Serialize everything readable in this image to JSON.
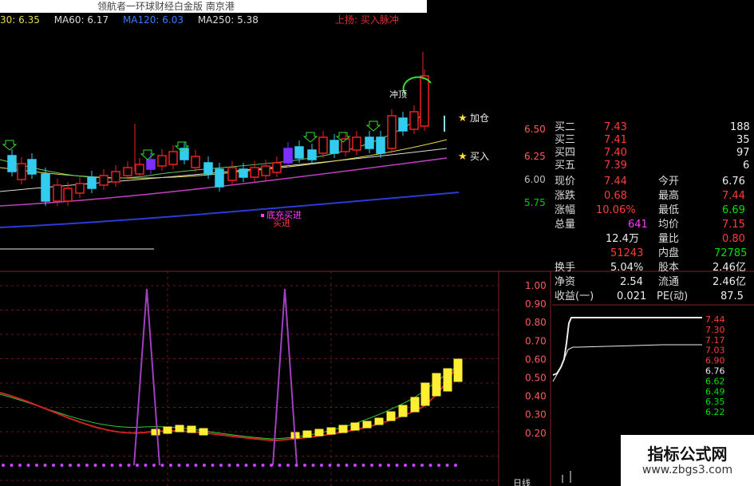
{
  "title": "领航者一环球财经白金版   南京港",
  "ma_bar": [
    {
      "text": "30: 6.35",
      "color": "#e8d84a"
    },
    {
      "text": "MA60: 6.17",
      "color": "#dcdcdc"
    },
    {
      "text": "MA120: 6.03",
      "color": "#3b7bff"
    },
    {
      "text": "MA250: 5.38",
      "color": "#dcdcdc"
    }
  ],
  "signal_text": "上扬: 买入脉冲",
  "price_axis": [
    "6.50",
    "6.25",
    "6.00",
    "5.75"
  ],
  "annotations": {
    "jia_cang": "加仓",
    "mai_ru": "买入",
    "chong": "冲顶",
    "bottom1": "底充买进",
    "bottom2": "买进"
  },
  "osc_axis": [
    "1.00",
    "0.90",
    "0.80",
    "0.70",
    "0.60",
    "0.50",
    "0.40",
    "0.30",
    "0.20"
  ],
  "mini_axis": [
    "7.44",
    "7.30",
    "7.17",
    "7.03",
    "6.90",
    "6.76",
    "6.62",
    "6.49",
    "6.35",
    "6.22"
  ],
  "mini_axis_colors": [
    "#ff3b3b",
    "#ff3b3b",
    "#ff3b3b",
    "#ff3b3b",
    "#ff3b3b",
    "#eeeeee",
    "#00e000",
    "#00e000",
    "#00e000",
    "#00e000"
  ],
  "order_book": [
    {
      "label": "买二",
      "price": "7.43",
      "vol": "188"
    },
    {
      "label": "买三",
      "price": "7.41",
      "vol": "35"
    },
    {
      "label": "买四",
      "price": "7.40",
      "vol": "97"
    },
    {
      "label": "买五",
      "price": "7.39",
      "vol": "6"
    }
  ],
  "quote": {
    "xianjia_lbl": "现价",
    "xianjia": "7.44",
    "jinkai_lbl": "今开",
    "jinkai": "6.76",
    "zhangdie_lbl": "涨跌",
    "zhangdie": "0.68",
    "zuigao_lbl": "最高",
    "zuigao": "7.44",
    "zhangfu_lbl": "涨幅",
    "zhangfu": "10.06%",
    "zuidi_lbl": "最低",
    "zuidi": "6.69",
    "zongliang_lbl": "总量",
    "zongliang": "641",
    "junjia_lbl": "均价",
    "junjia": "7.15",
    "liang": "12.4万",
    "liangbi_lbl": "量比",
    "liangbi": "0.80",
    "waipan": "51243",
    "neipan_lbl": "内盘",
    "neipan": "72785",
    "huanshou_lbl": "换手",
    "huanshou": "5.04%",
    "guben_lbl": "股本",
    "guben": "2.46亿",
    "jingzi_lbl": "净资",
    "jingzi": "2.54",
    "liutong_lbl": "流通",
    "liutong": "2.46亿",
    "shouyi_lbl": "收益(一)",
    "shouyi": "0.021",
    "pe_lbl": "PE(动)",
    "pe": "87.5"
  },
  "bottom_right_label": "日线",
  "watermark": {
    "line1": "指标公式网",
    "line2": "www.zbgs3.com"
  }
}
